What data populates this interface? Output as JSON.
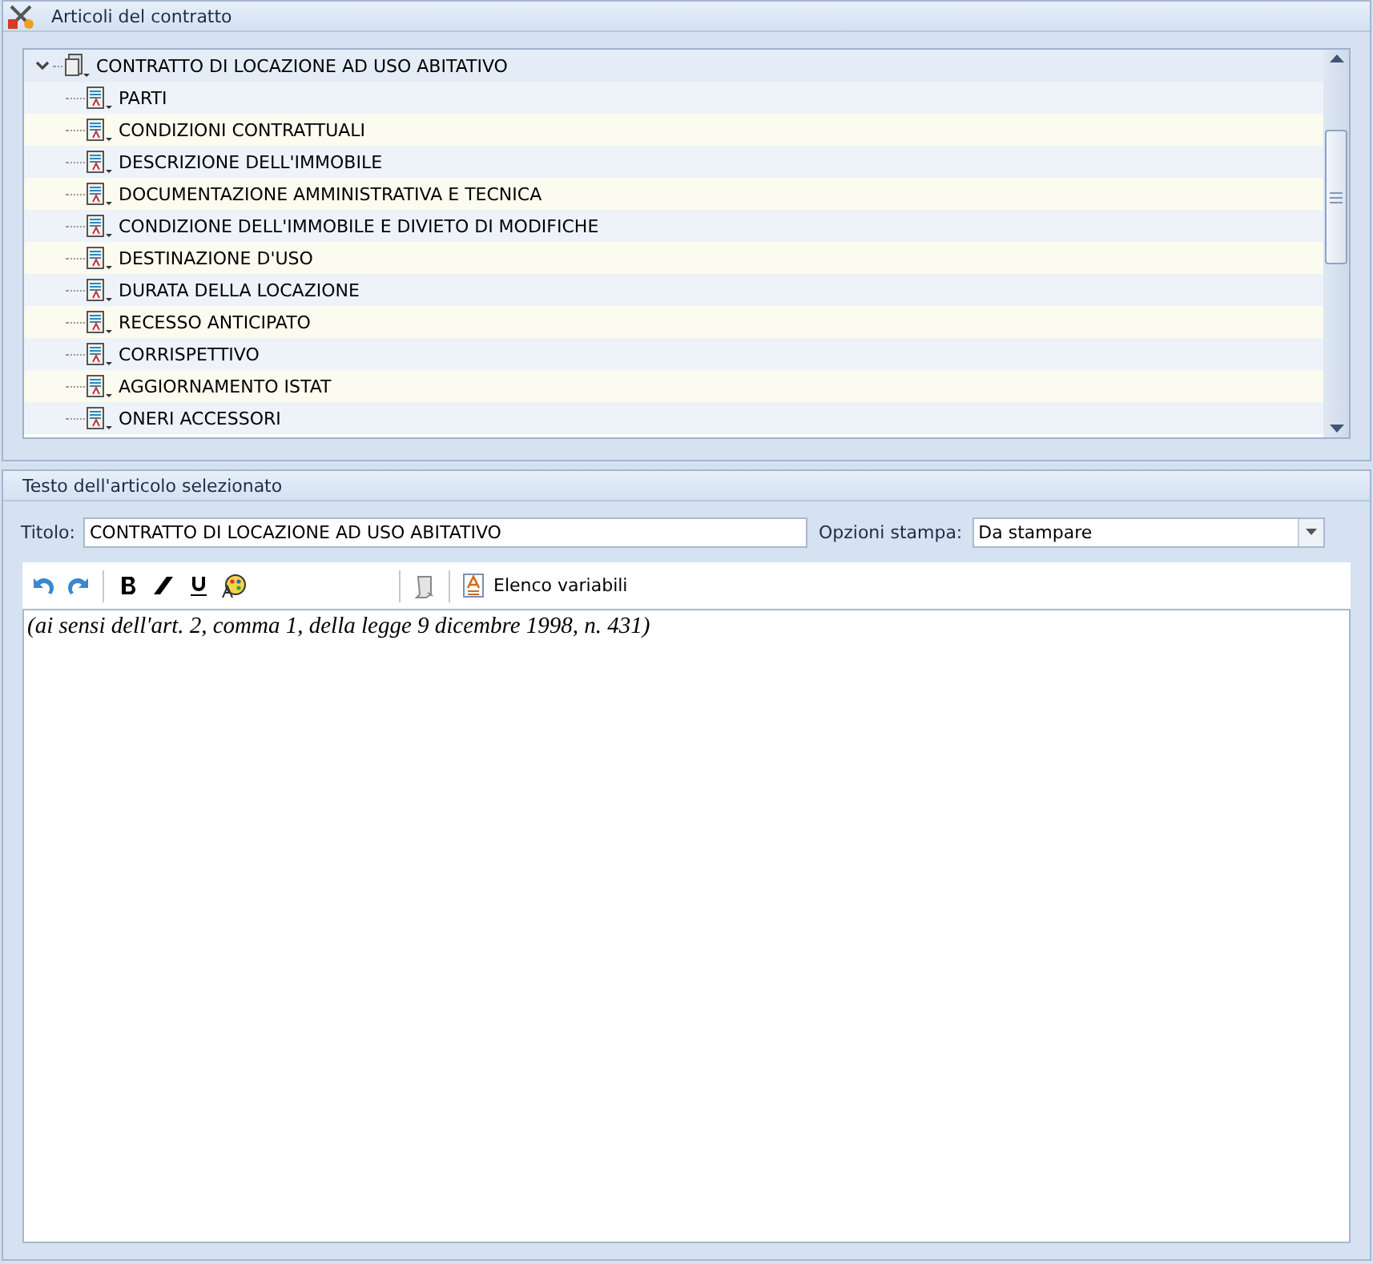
{
  "articles_panel": {
    "title": "Articoli del contratto",
    "tree": [
      {
        "label": "CONTRATTO DI LOCAZIONE AD USO ABITATIVO",
        "expanded": true,
        "children": [
          {
            "label": "PARTI"
          },
          {
            "label": "CONDIZIONI CONTRATTUALI"
          },
          {
            "label": "DESCRIZIONE DELL'IMMOBILE"
          },
          {
            "label": "DOCUMENTAZIONE AMMINISTRATIVA E TECNICA"
          },
          {
            "label": "CONDIZIONE DELL'IMMOBILE E DIVIETO DI MODIFICHE"
          },
          {
            "label": "DESTINAZIONE D'USO"
          },
          {
            "label": "DURATA DELLA LOCAZIONE"
          },
          {
            "label": "RECESSO ANTICIPATO"
          },
          {
            "label": "CORRISPETTIVO"
          },
          {
            "label": "AGGIORNAMENTO ISTAT"
          },
          {
            "label": "ONERI ACCESSORI"
          }
        ]
      }
    ]
  },
  "text_panel": {
    "title": "Testo dell'articolo selezionato",
    "title_label": "Titolo:",
    "title_value": "CONTRATTO DI LOCAZIONE AD USO ABITATIVO",
    "print_label": "Opzioni stampa:",
    "print_value": "Da stampare",
    "toolbar": {
      "variables_button": "Elenco variabili"
    },
    "body": "(ai sensi dell'art. 2, comma 1, della legge 9 dicembre 1998, n. 431)"
  }
}
